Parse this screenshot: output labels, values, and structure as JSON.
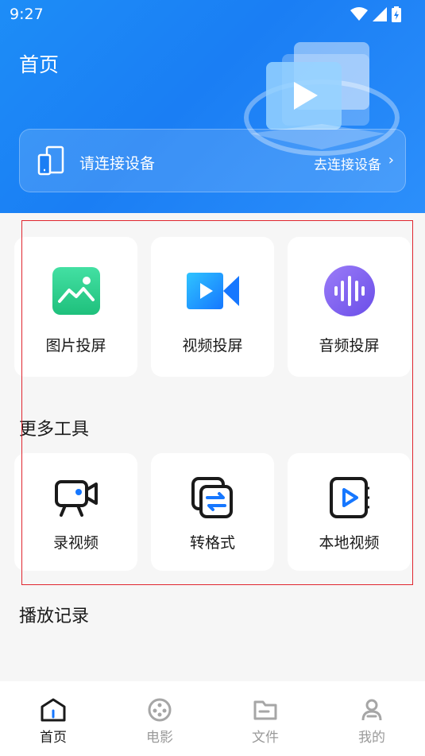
{
  "status": {
    "time": "9:27"
  },
  "header": {
    "title": "首页",
    "connect_label": "请连接设备",
    "connect_action": "去连接设备",
    "chevron": "›"
  },
  "cast_tiles": [
    {
      "label": "图片投屏",
      "icon": "image-icon"
    },
    {
      "label": "视频投屏",
      "icon": "video-camera-icon"
    },
    {
      "label": "音频投屏",
      "icon": "audio-wave-icon"
    }
  ],
  "more_tools": {
    "title": "更多工具",
    "items": [
      {
        "label": "录视频",
        "icon": "record-camera-icon"
      },
      {
        "label": "转格式",
        "icon": "convert-icon"
      },
      {
        "label": "本地视频",
        "icon": "local-video-icon"
      }
    ]
  },
  "history": {
    "title": "播放记录"
  },
  "nav": {
    "items": [
      {
        "label": "首页",
        "icon": "home-icon",
        "active": true
      },
      {
        "label": "电影",
        "icon": "film-reel-icon",
        "active": false
      },
      {
        "label": "文件",
        "icon": "folder-icon",
        "active": false
      },
      {
        "label": "我的",
        "icon": "profile-icon",
        "active": false
      }
    ]
  },
  "colors": {
    "header_blue": "#1a7ef4",
    "accent_blue": "#1677ff",
    "green": "#2fcf8f",
    "purple": "#7b5cf2",
    "highlight_red": "#e0262f"
  }
}
